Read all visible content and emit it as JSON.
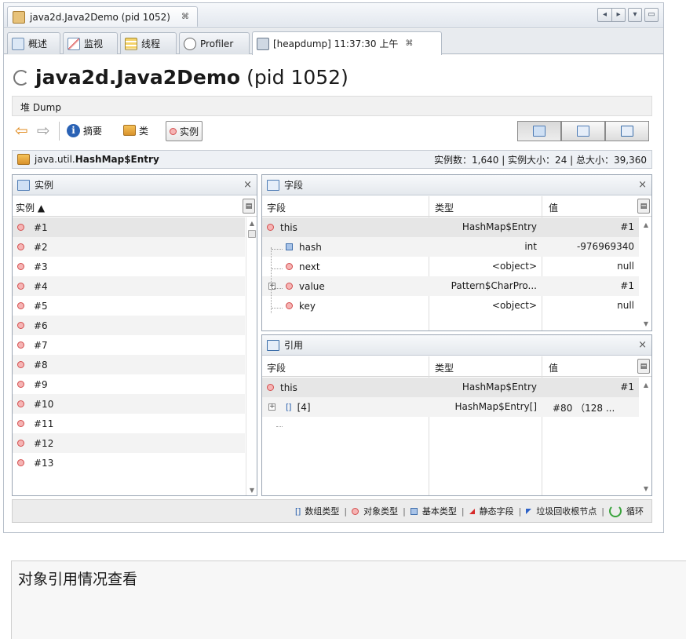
{
  "window": {
    "title": "java2d.Java2Demo (pid 1052)",
    "close_glyph": "⌘"
  },
  "tabs": [
    {
      "label": "概述",
      "icon": "overview-icon"
    },
    {
      "label": "监视",
      "icon": "monitor-icon"
    },
    {
      "label": "线程",
      "icon": "threads-icon"
    },
    {
      "label": "Profiler",
      "icon": "profiler-icon"
    },
    {
      "label": "[heapdump] 11:37:30 上午",
      "icon": "heapdump-icon",
      "close": "⌘",
      "active": true
    }
  ],
  "heading": {
    "app": "java2d.Java2Demo",
    "pid": "(pid 1052)"
  },
  "subheader": "堆 Dump",
  "toolbar": {
    "back_icon": "⇦",
    "forward_icon": "⇨",
    "summary": "摘要",
    "classes": "类",
    "instances": "实例"
  },
  "classbar": {
    "class_prefix": "java.util.",
    "class_bold": "HashMap$Entry",
    "stats": "实例数：1,640 | 实例大小：24 | 总大小：39,360"
  },
  "instances_pane": {
    "title": "实例",
    "column": "实例 ▲",
    "items": [
      "#1",
      "#2",
      "#3",
      "#4",
      "#5",
      "#6",
      "#7",
      "#8",
      "#9",
      "#10",
      "#11",
      "#12",
      "#13"
    ]
  },
  "fields_pane": {
    "title": "字段",
    "columns": {
      "field": "字段",
      "type": "类型",
      "value": "值"
    },
    "rows": [
      {
        "name": "this",
        "type": "HashMap$Entry",
        "value": "#1",
        "kind": "object"
      },
      {
        "name": "hash",
        "type": "int",
        "value": "-976969340",
        "kind": "primitive"
      },
      {
        "name": "next",
        "type": "<object>",
        "value": "null",
        "kind": "object"
      },
      {
        "name": "value",
        "type": "Pattern$CharPro...",
        "value": "#1",
        "kind": "object"
      },
      {
        "name": "key",
        "type": "<object>",
        "value": "null",
        "kind": "object"
      }
    ]
  },
  "refs_pane": {
    "title": "引用",
    "columns": {
      "field": "字段",
      "type": "类型",
      "value": "值"
    },
    "rows": [
      {
        "name": "this",
        "type": "HashMap$Entry",
        "value": "#1",
        "kind": "object"
      },
      {
        "name": "[4]",
        "type": "HashMap$Entry[]",
        "value": "#80 （128 ...",
        "kind": "array"
      }
    ]
  },
  "legend": {
    "array": "数组类型",
    "object": "对象类型",
    "primitive": "基本类型",
    "static": "静态字段",
    "gc_root": "垃圾回收根节点",
    "loop": "循环",
    "separator": "|"
  },
  "caption": "对象引用情况查看",
  "close_x": "×",
  "colors": {
    "object_marker": "#d24d4d",
    "primitive_marker": "#3f6eab",
    "gc_root": "#2e62c7",
    "static": "#d62b2b"
  }
}
